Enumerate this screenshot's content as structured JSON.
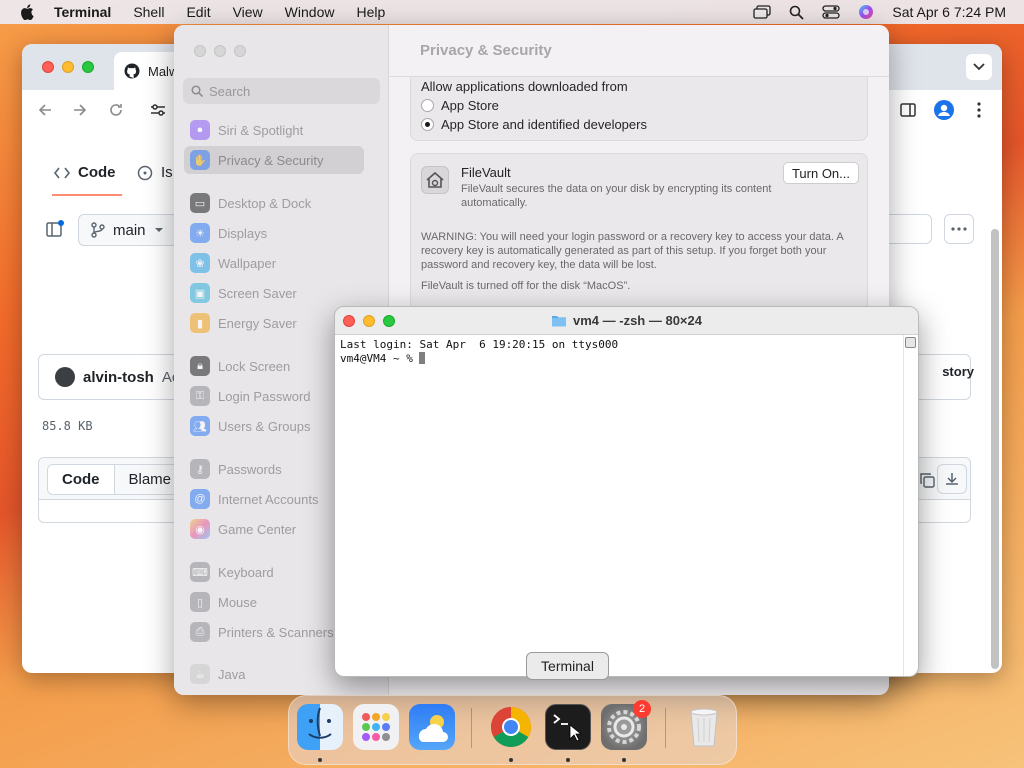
{
  "menubar": {
    "app": "Terminal",
    "items": [
      "Shell",
      "Edit",
      "View",
      "Window",
      "Help"
    ],
    "clock": "Sat Apr 6  7:24 PM"
  },
  "browser": {
    "tab_title": "Malw",
    "repo_tabs": [
      {
        "label": "Code",
        "icon": "code-icon"
      },
      {
        "label": "Is",
        "icon": "issue-icon"
      }
    ],
    "branch": "main",
    "commit_user": "alvin-tosh",
    "commit_message": "Ac",
    "history_label": "story",
    "file_size": "85.8 KB",
    "view_modes": [
      "Code",
      "Blame"
    ]
  },
  "settings": {
    "title": "Privacy & Security",
    "search_placeholder": "Search",
    "sidebar": [
      {
        "label": "Siri & Spotlight",
        "icon": "siri-icon",
        "color": "#8a5cf6"
      },
      {
        "label": "Privacy & Security",
        "icon": "hand-icon",
        "color": "#3a7bf0",
        "selected": true
      },
      {
        "label": "Desktop & Dock",
        "icon": "dock-icon",
        "color": "#1f1f1f"
      },
      {
        "label": "Displays",
        "icon": "sun-icon",
        "color": "#2e7cf6"
      },
      {
        "label": "Wallpaper",
        "icon": "flower-icon",
        "color": "#29a3e6"
      },
      {
        "label": "Screen Saver",
        "icon": "screensaver-icon",
        "color": "#2fb0d9"
      },
      {
        "label": "Energy Saver",
        "icon": "battery-icon",
        "color": "#f2a619"
      },
      {
        "label": "Lock Screen",
        "icon": "lock-icon",
        "color": "#1f1f1f"
      },
      {
        "label": "Login Password",
        "icon": "key-icon",
        "color": "#8e8e93"
      },
      {
        "label": "Users & Groups",
        "icon": "users-icon",
        "color": "#2e7cf6"
      },
      {
        "label": "Passwords",
        "icon": "password-key-icon",
        "color": "#8e8e93"
      },
      {
        "label": "Internet Accounts",
        "icon": "at-icon",
        "color": "#2e7cf6"
      },
      {
        "label": "Game Center",
        "icon": "game-center-icon",
        "color": "#e8559a"
      },
      {
        "label": "Keyboard",
        "icon": "keyboard-icon",
        "color": "#8e8e93"
      },
      {
        "label": "Mouse",
        "icon": "mouse-icon",
        "color": "#8e8e93"
      },
      {
        "label": "Printers & Scanners",
        "icon": "printer-icon",
        "color": "#8e8e93"
      },
      {
        "label": "Java",
        "icon": "java-icon",
        "color": "#c9c9c9"
      }
    ],
    "allow_heading": "Allow applications downloaded from",
    "allow_options": [
      {
        "label": "App Store",
        "checked": false
      },
      {
        "label": "App Store and identified developers",
        "checked": true
      }
    ],
    "filevault": {
      "title": "FileVault",
      "description": "FileVault secures the data on your disk by encrypting its content automatically.",
      "button": "Turn On...",
      "warning": "WARNING: You will need your login password or a recovery key to access your data. A recovery key is automatically generated as part of this setup. If you forget both your password and recovery key, the data will be lost.",
      "status": "FileVault is turned off for the disk “MacOS”."
    }
  },
  "terminal": {
    "title": "vm4 — -zsh — 80×24",
    "line1": "Last login: Sat Apr  6 19:20:15 on ttys000",
    "prompt": "vm4@VM4 ~ % "
  },
  "tooltip": "Terminal",
  "dock": {
    "apps": [
      "Finder",
      "Launchpad",
      "Weather",
      "Google Chrome",
      "Terminal",
      "System Settings",
      "Trash"
    ],
    "settings_badge": "2"
  }
}
